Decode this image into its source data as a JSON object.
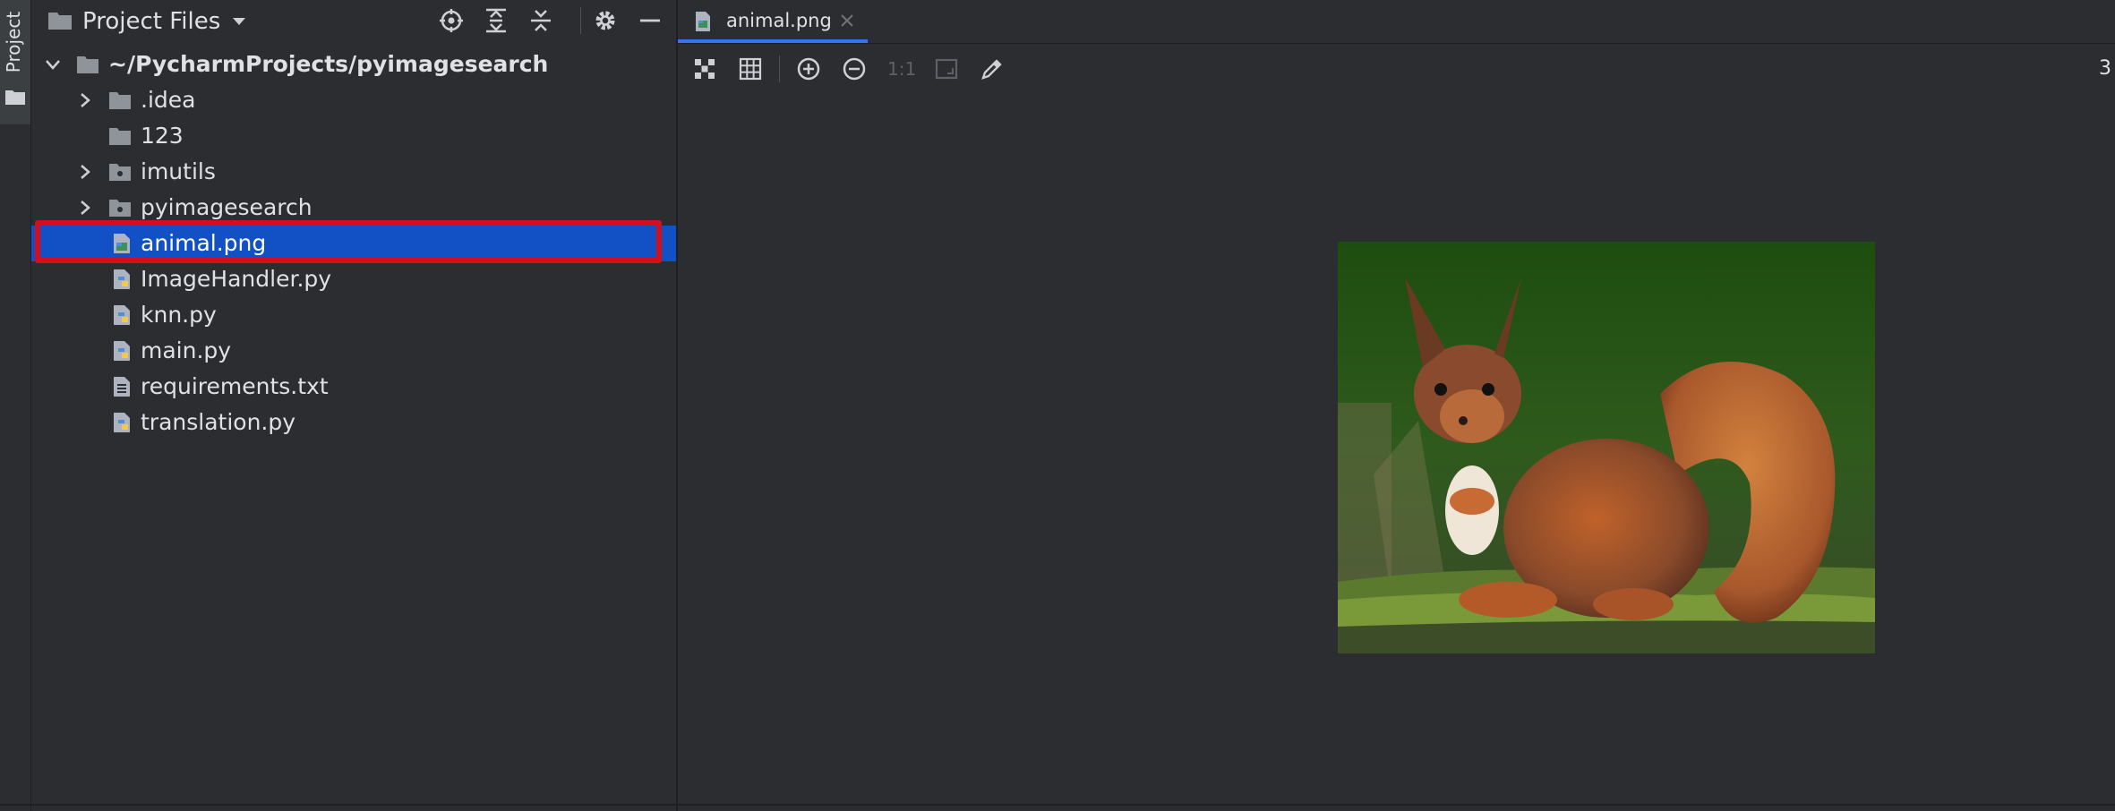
{
  "tool_strip": {
    "label": "Project"
  },
  "panel": {
    "title": "Project Files"
  },
  "tree": {
    "root": "~/PycharmProjects/pyimagesearch",
    "items": [
      {
        "label": ".idea"
      },
      {
        "label": "123"
      },
      {
        "label": "imutils"
      },
      {
        "label": "pyimagesearch"
      },
      {
        "label": "animal.png"
      },
      {
        "label": "ImageHandler.py"
      },
      {
        "label": "knn.py"
      },
      {
        "label": "main.py"
      },
      {
        "label": "requirements.txt"
      },
      {
        "label": "translation.py"
      }
    ]
  },
  "editor": {
    "tab_label": "animal.png",
    "zoom_label": "1:1",
    "info_text": "3"
  },
  "colors": {
    "background": "#2b2d30",
    "selection": "#1250c6",
    "highlight_box": "#d40e1b",
    "tab_accent": "#3574f0"
  },
  "icons": {
    "folder": "folder-icon",
    "python": "python-file-icon",
    "image": "image-file-icon",
    "text": "text-file-icon"
  }
}
